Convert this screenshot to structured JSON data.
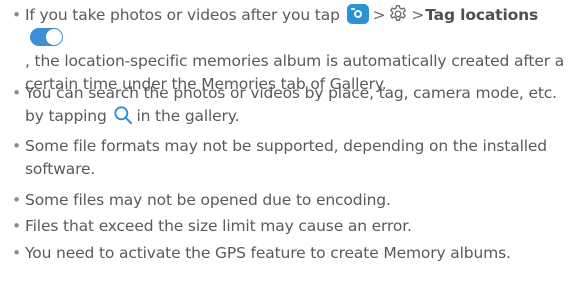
{
  "notes": [
    {
      "bullet": "•",
      "pre": "If you take photos or videos after you tap",
      "sep1": ">",
      "sep2": ">",
      "bold": "Tag locations",
      "post": ", the location-specific memories album is automatically created after a certain time under the Memories tab of Gallery.",
      "icons": [
        "camera-app-icon",
        "gear-icon",
        "toggle-on-icon"
      ]
    },
    {
      "bullet": "•",
      "pre": "You can search the photos or videos by place, tag, camera mode, etc. by tapping",
      "post": "in the gallery.",
      "icons": [
        "search-icon"
      ]
    },
    {
      "bullet": "•",
      "text": "Some file formats may not be supported, depending on the installed software."
    },
    {
      "bullet": "•",
      "text": "Some files may not be opened due to encoding."
    },
    {
      "bullet": "•",
      "text": "Files that exceed the size limit may cause an error."
    },
    {
      "bullet": "•",
      "text": "You need to activate the GPS feature to create Memory albums."
    }
  ],
  "colors": {
    "text": "#5a5a5a",
    "accent": "#3a8fd6",
    "camera_icon_bg": "#2a93d5"
  }
}
